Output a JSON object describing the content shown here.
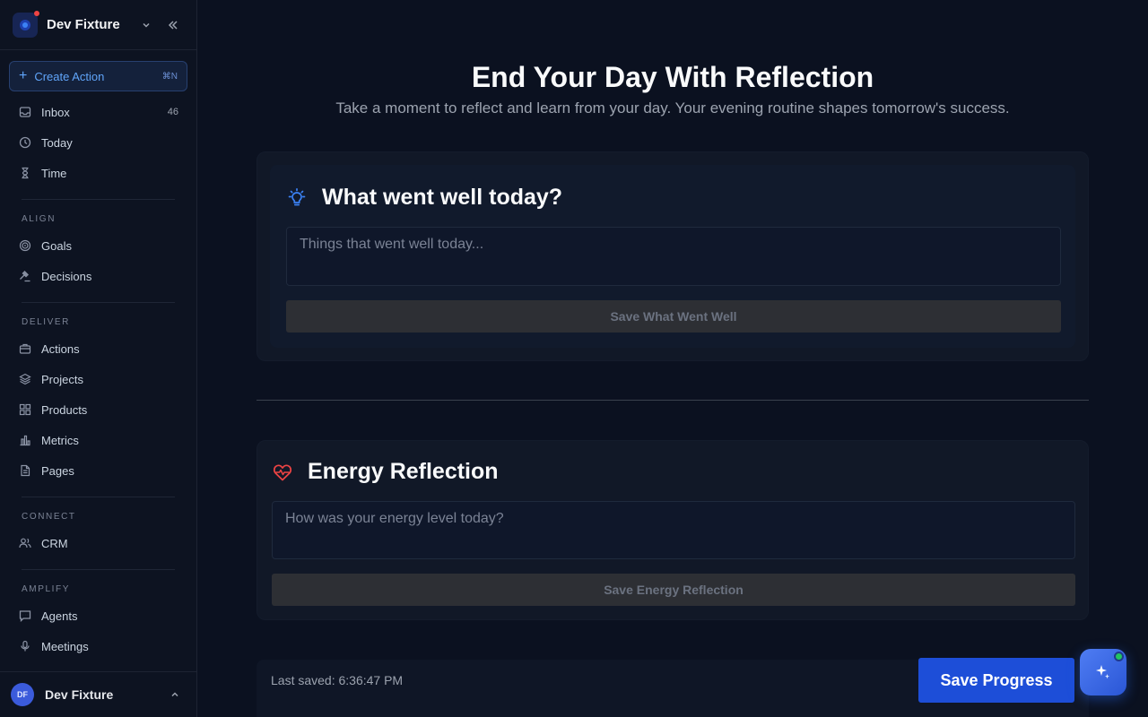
{
  "workspace": {
    "name": "Dev Fixture"
  },
  "create_action": {
    "label": "Create Action",
    "shortcut": "⌘N"
  },
  "nav_top": [
    {
      "label": "Inbox",
      "icon": "inbox-icon",
      "count": "46"
    },
    {
      "label": "Today",
      "icon": "clock-icon"
    },
    {
      "label": "Time",
      "icon": "hourglass-icon"
    }
  ],
  "sections": {
    "align": {
      "label": "ALIGN",
      "items": [
        {
          "label": "Goals",
          "icon": "target-icon"
        },
        {
          "label": "Decisions",
          "icon": "gavel-icon"
        }
      ]
    },
    "deliver": {
      "label": "DELIVER",
      "items": [
        {
          "label": "Actions",
          "icon": "briefcase-icon"
        },
        {
          "label": "Projects",
          "icon": "layers-icon"
        },
        {
          "label": "Products",
          "icon": "grid-icon"
        },
        {
          "label": "Metrics",
          "icon": "bar-chart-icon"
        },
        {
          "label": "Pages",
          "icon": "document-icon"
        }
      ]
    },
    "connect": {
      "label": "CONNECT",
      "items": [
        {
          "label": "CRM",
          "icon": "users-icon"
        }
      ]
    },
    "amplify": {
      "label": "AMPLIFY",
      "items": [
        {
          "label": "Agents",
          "icon": "chat-icon"
        },
        {
          "label": "Meetings",
          "icon": "mic-icon"
        }
      ]
    }
  },
  "user": {
    "initials": "DF",
    "name": "Dev Fixture"
  },
  "page": {
    "title": "End Your Day With Reflection",
    "subtitle": "Take a moment to reflect and learn from your day. Your evening routine shapes tomorrow's success."
  },
  "went_well": {
    "title": "What went well today?",
    "placeholder": "Things that went well today...",
    "button": "Save What Went Well"
  },
  "energy": {
    "title": "Energy Reflection",
    "placeholder": "How was your energy level today?",
    "button": "Save Energy Reflection"
  },
  "footer": {
    "last_saved": "Last saved: 6:36:47 PM",
    "save_button": "Save Progress"
  },
  "colors": {
    "accent": "#1d4ed8",
    "bulb": "#3b82f6",
    "heart": "#ef4444",
    "background": "#0b1120"
  }
}
